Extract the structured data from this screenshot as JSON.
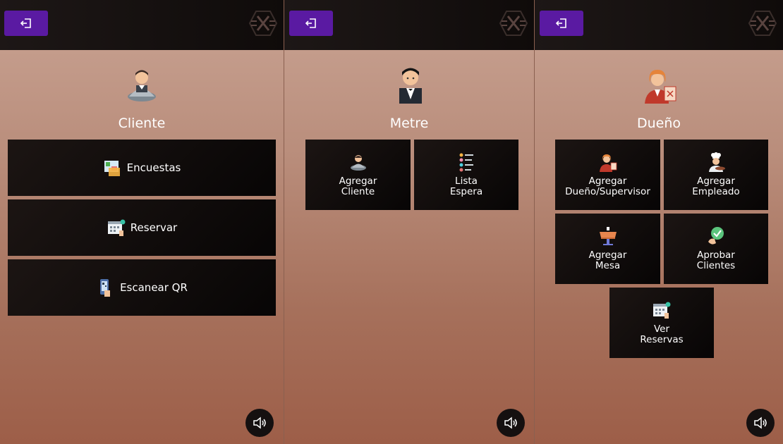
{
  "panels": [
    {
      "role": "Cliente",
      "buttons": [
        {
          "label": "Encuestas"
        },
        {
          "label": "Reservar"
        },
        {
          "label": "Escanear QR"
        }
      ]
    },
    {
      "role": "Metre",
      "buttons": [
        {
          "line1": "Agregar",
          "line2": "Cliente"
        },
        {
          "line1": "Lista",
          "line2": "Espera"
        }
      ]
    },
    {
      "role": "Dueño",
      "buttons": [
        {
          "line1": "Agregar",
          "line2": "Dueño/Supervisor"
        },
        {
          "line1": "Agregar",
          "line2": "Empleado"
        },
        {
          "line1": "Agregar",
          "line2": "Mesa"
        },
        {
          "line1": "Aprobar",
          "line2": "Clientes"
        },
        {
          "line1": "Ver",
          "line2": "Reservas"
        }
      ]
    }
  ],
  "icons": {
    "back": "logout-arrow-icon",
    "logo": "x-brand-logo",
    "sound": "speaker-volume-icon"
  },
  "colors": {
    "accent": "#5a1aa2",
    "tile": "#0d0908",
    "topbar": "#141010"
  }
}
